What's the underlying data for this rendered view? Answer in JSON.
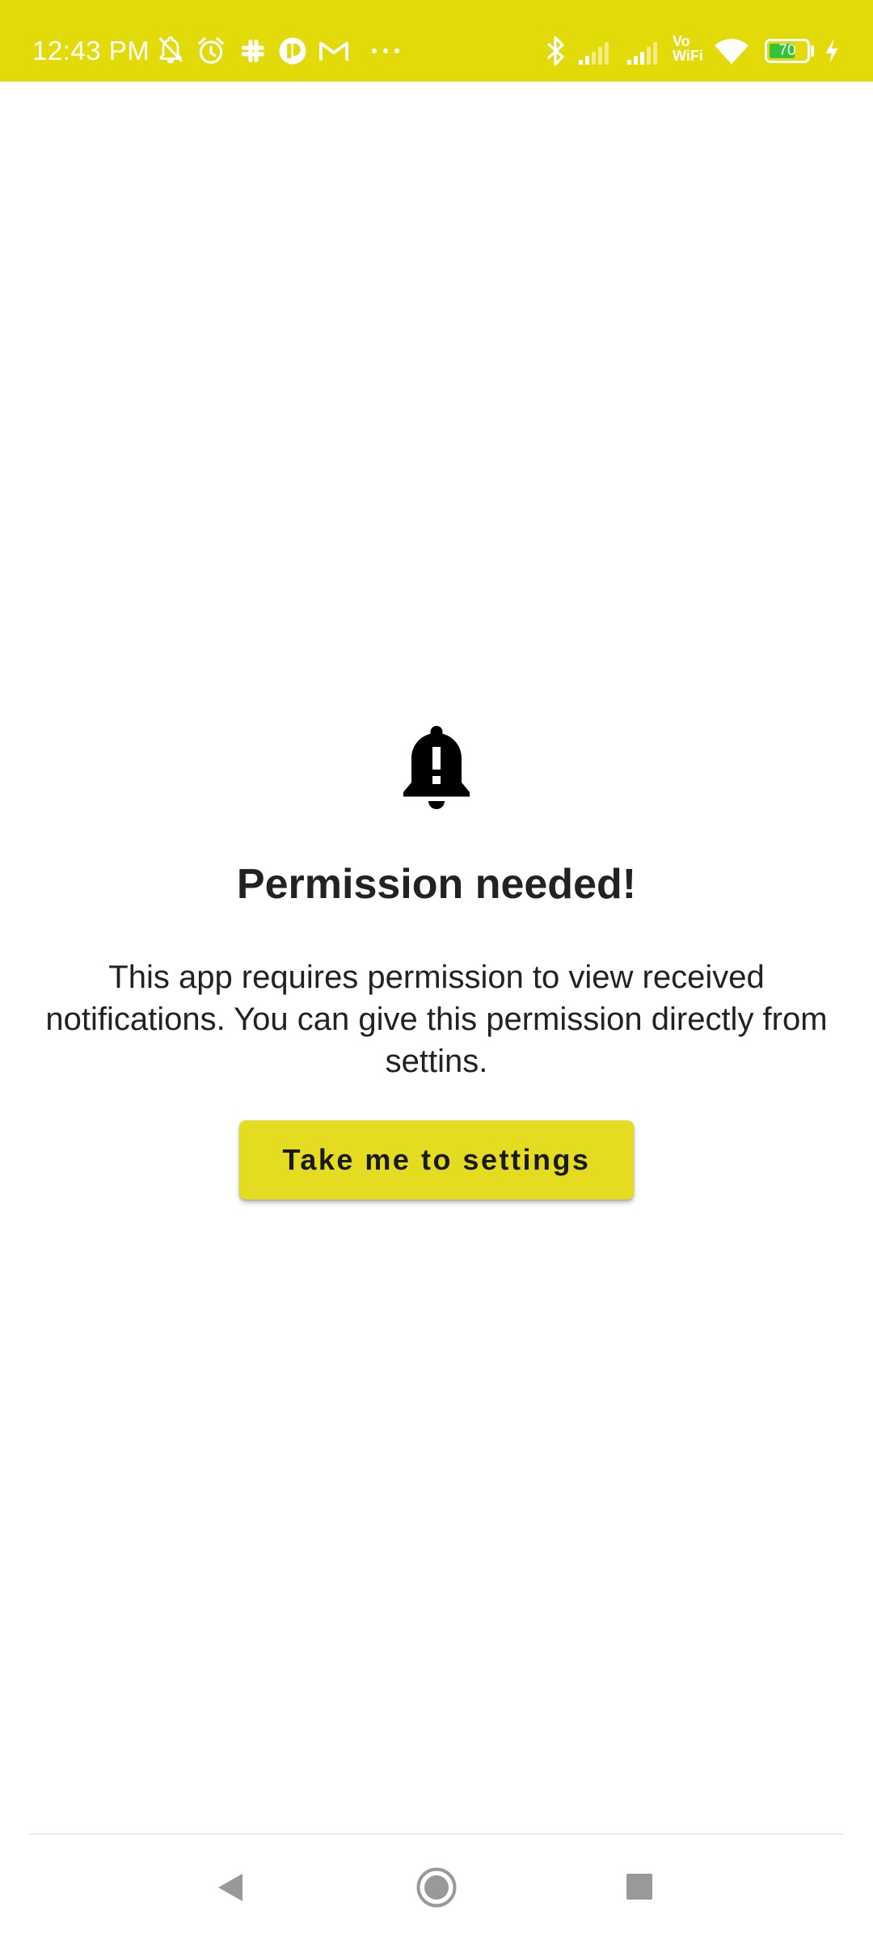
{
  "status_bar": {
    "time": "12:43 PM",
    "vowifi_line1": "Vo",
    "vowifi_line2": "WiFi",
    "battery_level": "70",
    "battery_fraction": 0.7,
    "background_color": "#e3da09",
    "icons": [
      "notifications-off-icon",
      "alarm-icon",
      "slack-icon",
      "app-icon",
      "gmail-icon",
      "more-dots-icon",
      "bluetooth-icon",
      "signal-1-icon",
      "signal-2-icon",
      "wifi-icon",
      "battery-icon",
      "charging-icon"
    ]
  },
  "main": {
    "icon": "notification-important-icon",
    "title": "Permission needed!",
    "description": "This app requires permission to view received notifications. You can give this permission directly from settins.",
    "button_label": "Take me to settings",
    "accent_color": "#e5dc22"
  },
  "nav_bar": {
    "buttons": [
      "back-icon",
      "home-icon",
      "recents-icon"
    ]
  }
}
